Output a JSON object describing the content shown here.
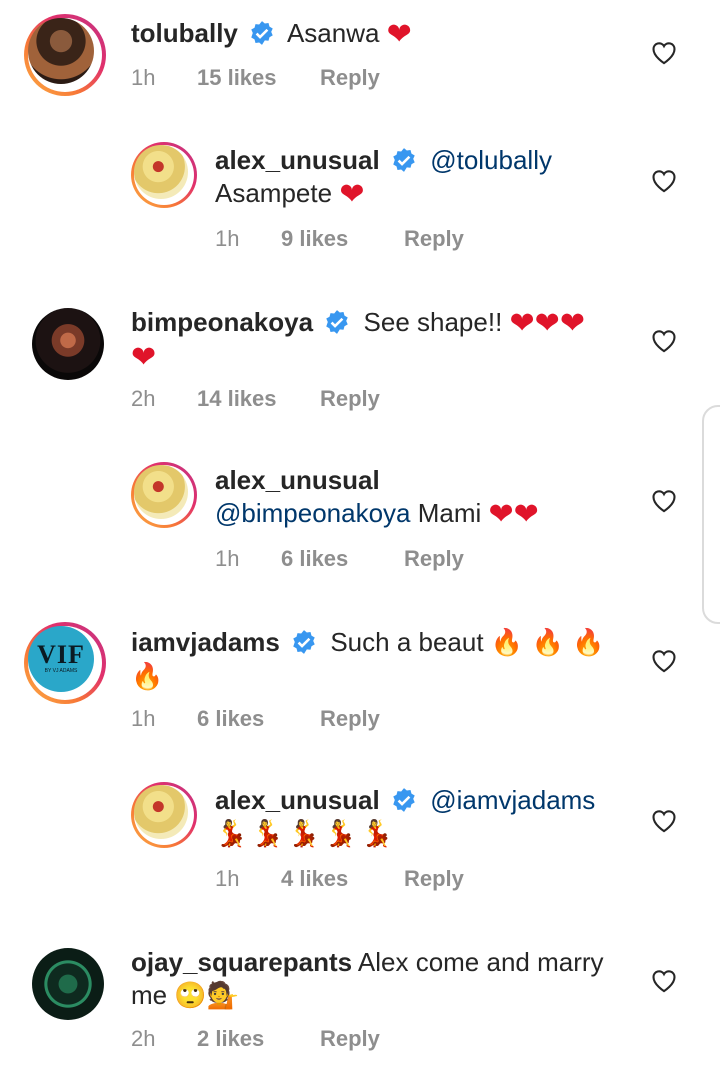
{
  "comments": [
    {
      "username": "tolubally",
      "verified": true,
      "mention": "",
      "text": "Asanwa",
      "emoji": "❤",
      "time": "1h",
      "likes": "15 likes",
      "reply": "Reply",
      "is_reply": false
    },
    {
      "username": "alex_unusual",
      "verified": true,
      "mention": "@tolubally",
      "text": "Asampete",
      "emoji": "❤",
      "time": "1h",
      "likes": "9 likes",
      "reply": "Reply",
      "is_reply": true
    },
    {
      "username": "bimpeonakoya",
      "verified": true,
      "mention": "",
      "text": "See shape!!",
      "emoji": "❤❤❤",
      "emoji2": "❤",
      "time": "2h",
      "likes": "14 likes",
      "reply": "Reply",
      "is_reply": false
    },
    {
      "username": "alex_unusual",
      "verified": false,
      "mention": "@bimpeonakoya",
      "text": "Mami",
      "emoji": "❤❤",
      "time": "1h",
      "likes": "6 likes",
      "reply": "Reply",
      "is_reply": true
    },
    {
      "username": "iamvjadams",
      "verified": true,
      "mention": "",
      "text": "Such a beaut",
      "emoji": "🔥 🔥 🔥",
      "emoji2": "🔥",
      "time": "1h",
      "likes": "6 likes",
      "reply": "Reply",
      "is_reply": false,
      "avatar_logo": "VIF",
      "avatar_sub": "BY VJ ADAMS"
    },
    {
      "username": "alex_unusual",
      "verified": true,
      "mention": "@iamvjadams",
      "text": "",
      "emoji": "💃💃💃💃💃",
      "time": "1h",
      "likes": "4 likes",
      "reply": "Reply",
      "is_reply": true
    },
    {
      "username": "ojay_squarepants",
      "verified": false,
      "mention": "",
      "text": "Alex come and marry",
      "text2": "me",
      "emoji": "🙄💁",
      "time": "2h",
      "likes": "2 likes",
      "reply": "Reply",
      "is_reply": false
    }
  ],
  "icons": {
    "like": "heart-outline-icon",
    "verified": "verified-badge-icon"
  },
  "colors": {
    "verified": "#3897f0",
    "heart": "#e0142a",
    "mention": "#00376b",
    "meta": "#8e8e8e"
  }
}
